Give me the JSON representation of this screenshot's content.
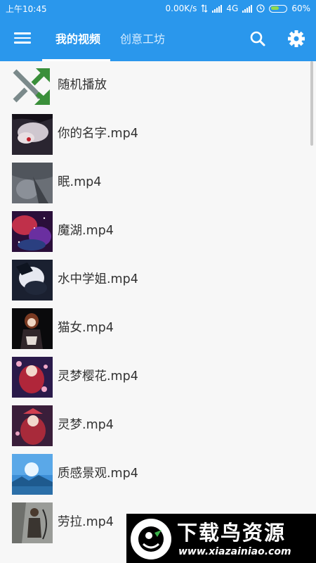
{
  "status_bar": {
    "time": "上午10:45",
    "network_speed": "0.00K/s",
    "network_type": "4G",
    "battery": "60%",
    "battery_level": 0.6,
    "icons": [
      "data-arrows-icon",
      "signal-icon",
      "alarm-icon",
      "battery-icon"
    ]
  },
  "app_bar": {
    "menu_icon": "hamburger-menu-icon",
    "tabs": [
      {
        "label": "我的视频",
        "selected": true
      },
      {
        "label": "创意工坊",
        "selected": false
      }
    ],
    "actions": [
      "search-icon",
      "gear-icon"
    ]
  },
  "video_list": [
    {
      "label": "随机播放",
      "icon": "shuffle-icon"
    },
    {
      "label": "你的名字.mp4"
    },
    {
      "label": "眠.mp4"
    },
    {
      "label": "魔湖.mp4"
    },
    {
      "label": "水中学姐.mp4"
    },
    {
      "label": "猫女.mp4"
    },
    {
      "label": "灵梦樱花.mp4"
    },
    {
      "label": "灵梦.mp4"
    },
    {
      "label": "质感景观.mp4"
    },
    {
      "label": "劳拉.mp4"
    }
  ],
  "watermark": {
    "title": "下载鸟资源",
    "url": "www.xiazainiao.com"
  },
  "colors": {
    "primary": "#2a97ec",
    "background": "#f7f7f7",
    "text": "#333333",
    "shuffle_gray": "#7b8a8b",
    "shuffle_green": "#3a8f3a"
  }
}
